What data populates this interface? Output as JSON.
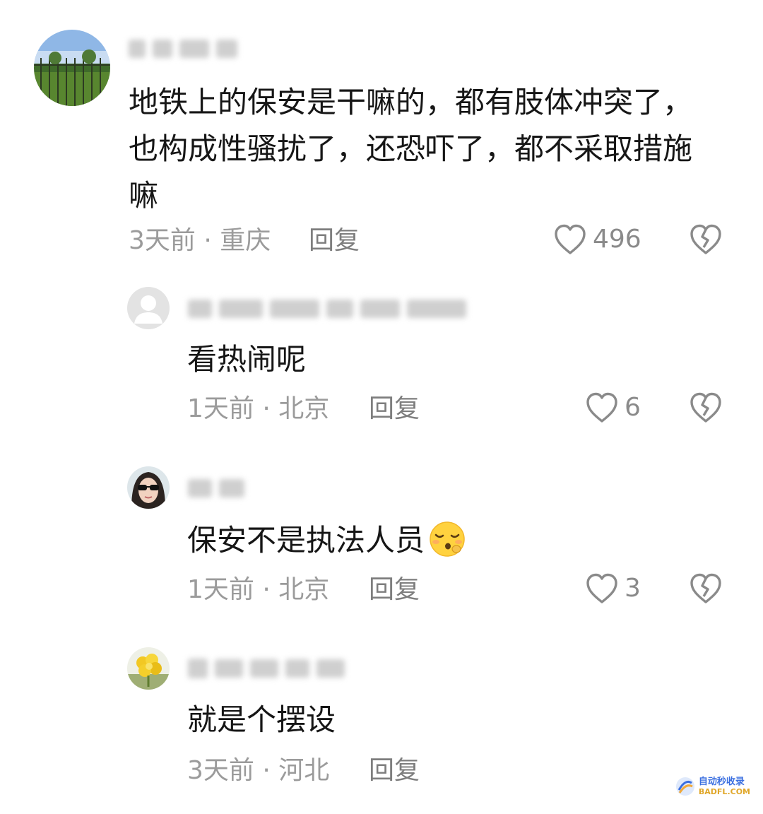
{
  "comments": [
    {
      "text": "地铁上的保安是干嘛的，都有肢体冲突了，也构成性骚扰了，还恐吓了，都不采取措施嘛",
      "time": "3天前",
      "location": "重庆",
      "reply_label": "回复",
      "likes": "496"
    },
    {
      "text": "看热闹呢",
      "time": "1天前",
      "location": "北京",
      "reply_label": "回复",
      "likes": "6"
    },
    {
      "text": "保安不是执法人员",
      "time": "1天前",
      "location": "北京",
      "reply_label": "回复",
      "likes": "3"
    },
    {
      "text": "就是个摆设",
      "time": "3天前",
      "location": "河北",
      "reply_label": "回复",
      "likes": ""
    }
  ],
  "meta_separator": "·",
  "icons": {
    "like": "heart-outline-icon",
    "dislike": "broken-heart-icon",
    "emoji": "pensive-face-emoji"
  },
  "watermark": {
    "line1": "自动秒收录",
    "line2": "BADFL.COM"
  },
  "colors": {
    "text": "#161616",
    "meta": "#9b9b9b",
    "icon": "#8a8a8a"
  }
}
